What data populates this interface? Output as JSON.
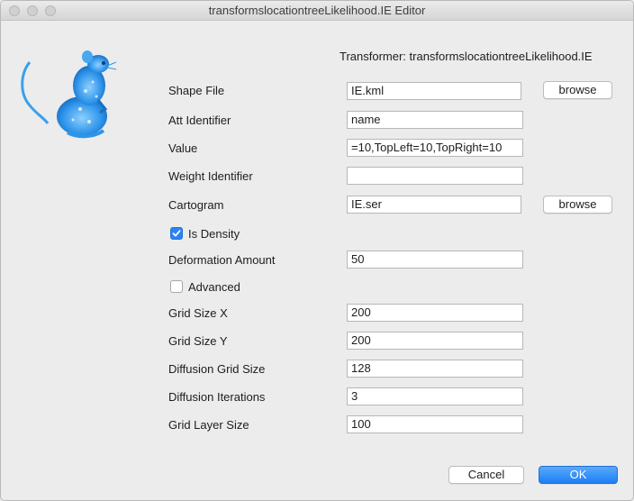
{
  "window": {
    "title": "transformslocationtreeLikelihood.IE Editor"
  },
  "logo": {
    "icon": "rat-logo-icon",
    "color": "#3aa0ee"
  },
  "header": {
    "transformer_label": "Transformer: transformslocationtreeLikelihood.IE"
  },
  "form": {
    "shape_file": {
      "label": "Shape File",
      "value": "IE.kml",
      "browse": "browse"
    },
    "att_identifier": {
      "label": "Att Identifier",
      "value": "name"
    },
    "value": {
      "label": "Value",
      "value": "=10,TopLeft=10,TopRight=10"
    },
    "weight_identifier": {
      "label": "Weight Identifier",
      "value": ""
    },
    "cartogram": {
      "label": "Cartogram",
      "value": "IE.ser",
      "browse": "browse"
    },
    "is_density": {
      "label": "Is Density",
      "checked": true
    },
    "deformation_amount": {
      "label": "Deformation Amount",
      "value": "50"
    },
    "advanced": {
      "label": "Advanced",
      "checked": false
    },
    "grid_size_x": {
      "label": "Grid Size X",
      "value": "200"
    },
    "grid_size_y": {
      "label": "Grid Size Y",
      "value": "200"
    },
    "diffusion_grid_size": {
      "label": "Diffusion Grid Size",
      "value": "128"
    },
    "diffusion_iterations": {
      "label": "Diffusion Iterations",
      "value": "3"
    },
    "grid_layer_size": {
      "label": "Grid Layer Size",
      "value": "100"
    }
  },
  "footer": {
    "cancel": "Cancel",
    "ok": "OK"
  },
  "colors": {
    "accent": "#1d7ef5",
    "checkbox": "#2b84f4"
  }
}
